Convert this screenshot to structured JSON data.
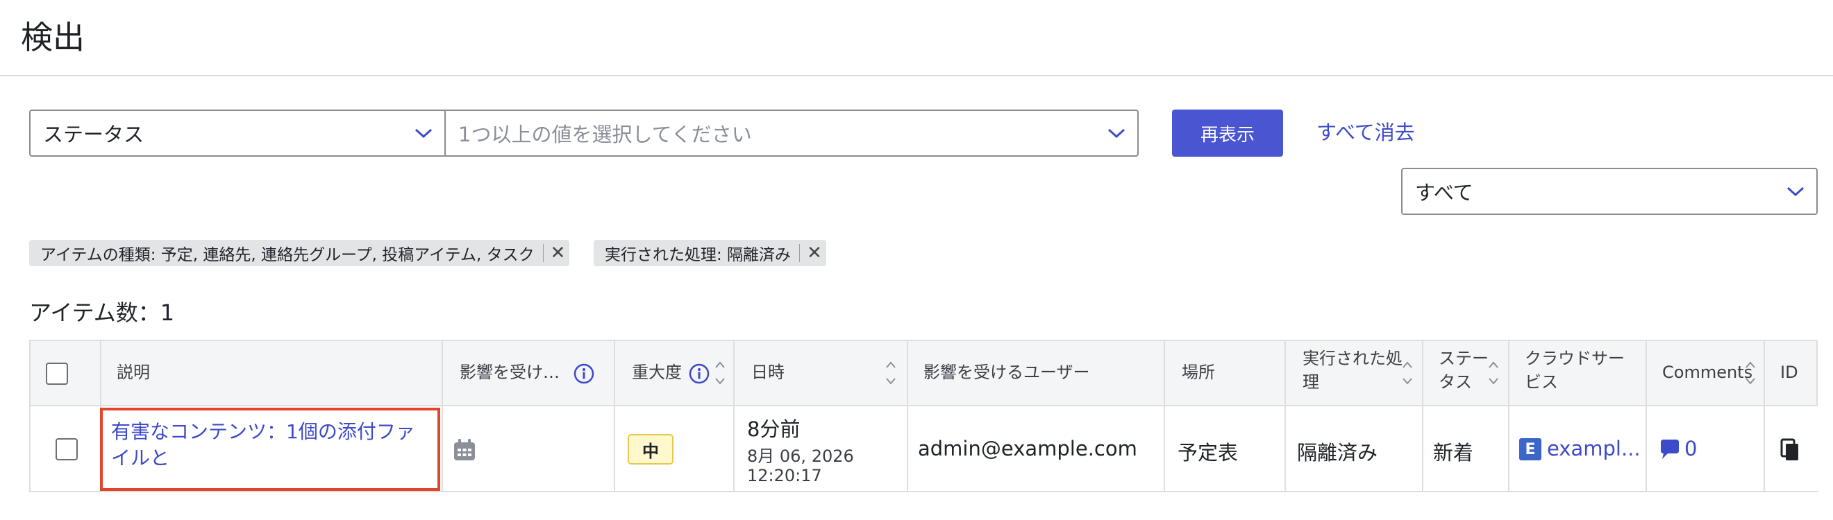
{
  "header": {
    "title": "検出"
  },
  "filters": {
    "field_select_value": "ステータス",
    "value_select_placeholder": "1つ以上の値を選択してください",
    "redisplay_label": "再表示",
    "clear_all_label": "すべて消去",
    "scope_select_value": "すべて"
  },
  "chips": [
    {
      "label": "アイテムの種類: 予定, 連絡先, 連絡先グループ, 投稿アイテム, タスク"
    },
    {
      "label": "実行された処理: 隔離済み"
    }
  ],
  "item_count": "アイテム数：1",
  "table": {
    "columns": {
      "description": "説明",
      "affected": "影響を受け…",
      "severity": "重大度",
      "datetime": "日時",
      "affected_user": "影響を受けるユーザー",
      "location": "場所",
      "action_line1": "実行された処",
      "action_line2": "理",
      "status_line1": "ステー",
      "status_line2": "タス",
      "cloud_line1": "クラウドサー",
      "cloud_line2": "ビス",
      "comments": "Comments",
      "id": "ID"
    },
    "rows": [
      {
        "description": "有害なコンテンツ：1個の添付ファイルと",
        "affected_icon": "calendar-icon",
        "severity": "中",
        "time_relative": "8分前",
        "date": "8月 06, 2026",
        "time": "12:20:17",
        "user": "admin@example.com",
        "location": "予定表",
        "action": "隔離済み",
        "status": "新着",
        "cloud_badge": "E",
        "cloud_service": "exampl...",
        "comments_count": "0",
        "id_icon": "copy-icon"
      }
    ]
  },
  "colors": {
    "accent": "#4a55d1",
    "link": "#3d4ac9",
    "highlight_border": "#e0452b",
    "severity_bg": "#fff8cc"
  }
}
